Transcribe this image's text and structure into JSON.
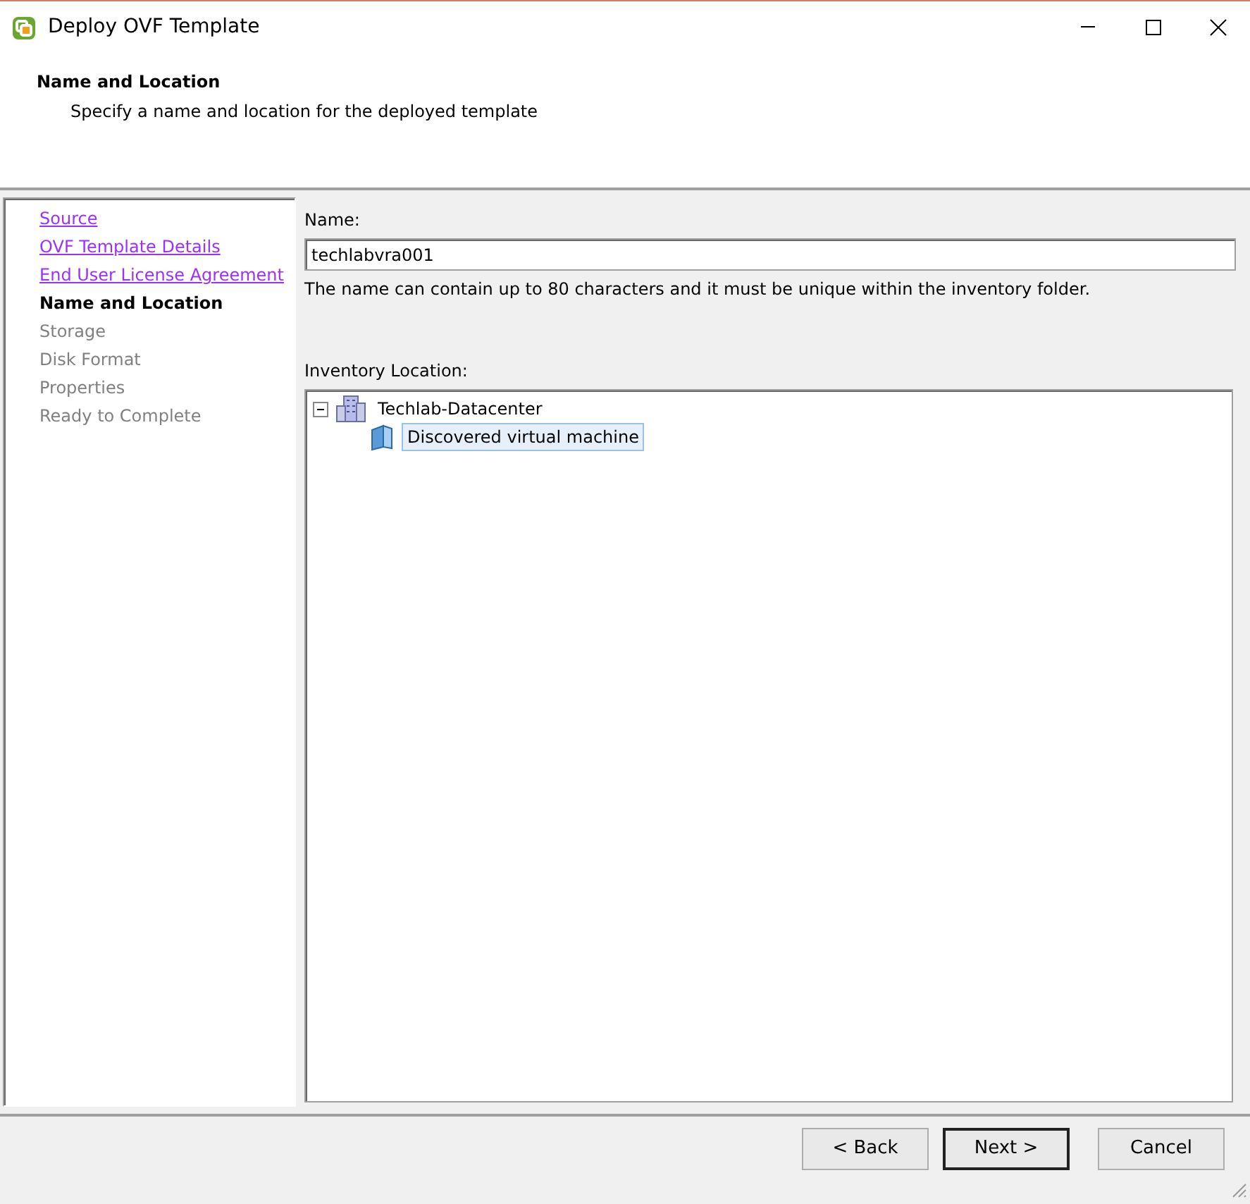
{
  "window": {
    "title": "Deploy OVF Template"
  },
  "header": {
    "title": "Name and Location",
    "subtitle": "Specify a name and location for the deployed template"
  },
  "steps": [
    {
      "label": "Source",
      "completed": true,
      "selected": false
    },
    {
      "label": "OVF Template Details",
      "completed": true,
      "selected": false
    },
    {
      "label": "End User License Agreement",
      "completed": true,
      "selected": false
    },
    {
      "label": "Name and Location",
      "completed": false,
      "selected": true
    },
    {
      "label": "Storage",
      "completed": false,
      "selected": false
    },
    {
      "label": "Disk Format",
      "completed": false,
      "selected": false
    },
    {
      "label": "Properties",
      "completed": false,
      "selected": false
    },
    {
      "label": "Ready to Complete",
      "completed": false,
      "selected": false
    }
  ],
  "name_field": {
    "label": "Name:",
    "value": "techlabvra001",
    "hint": "The name can contain up to 80 characters and it must be unique within the inventory folder."
  },
  "inventory": {
    "label": "Inventory Location:",
    "tree": [
      {
        "label": "Techlab-Datacenter",
        "kind": "datacenter",
        "expanded": true,
        "selected": false,
        "children": [
          {
            "label": "Discovered virtual machine",
            "kind": "folder",
            "selected": true
          }
        ]
      }
    ]
  },
  "buttons": [
    {
      "label": "< Back",
      "default": false
    },
    {
      "label": "Next >",
      "default": true
    },
    {
      "label": "Cancel",
      "default": false
    }
  ]
}
